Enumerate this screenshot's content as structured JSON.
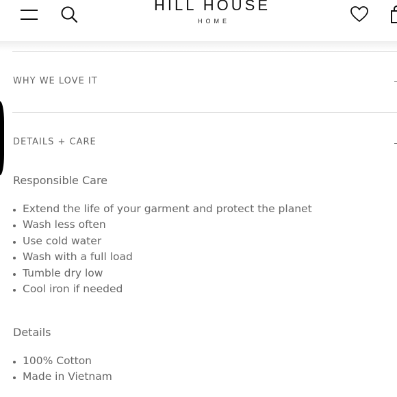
{
  "brand": {
    "name": "HILL HOUSE",
    "subtitle": "HOME"
  },
  "accordion": [
    {
      "label": "WHY WE LOVE IT",
      "state": "collapsed"
    },
    {
      "label": "DETAILS + CARE",
      "state": "expanded"
    }
  ],
  "care": {
    "heading": "Responsible Care",
    "items": [
      "Extend the life of your garment and protect the planet",
      "Wash less often",
      "Use cold water",
      "Wash with a full load",
      "Tumble dry low",
      "Cool iron if needed"
    ]
  },
  "details": {
    "heading": "Details",
    "items": [
      "100% Cotton",
      "Made in Vietnam"
    ]
  },
  "colors": {
    "text": "#666666",
    "divider": "#dddddd",
    "brand": "#111111"
  },
  "icons": [
    "menu-icon",
    "search-icon",
    "heart-icon",
    "shopping-bag-icon",
    "minus-icon"
  ]
}
